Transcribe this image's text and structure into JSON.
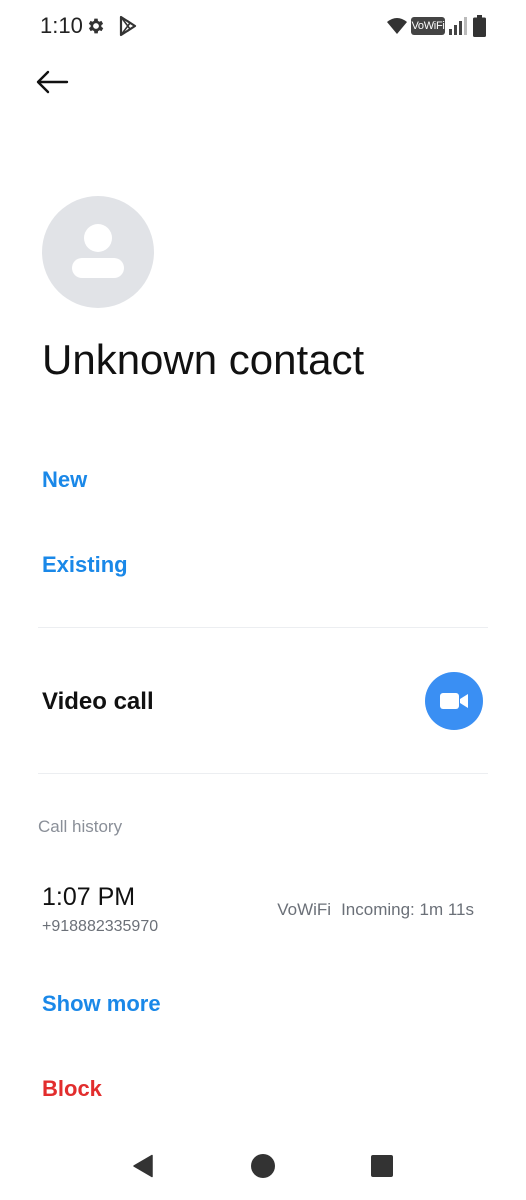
{
  "status_bar": {
    "time": "1:10",
    "icons": [
      "settings-icon",
      "play-store-icon",
      "wifi-icon",
      "vowifi-badge",
      "signal-icon",
      "battery-icon"
    ],
    "vowifi_label": "VoWiFi"
  },
  "header": {
    "back_icon": "arrow-left-icon"
  },
  "contact": {
    "avatar_icon": "person-placeholder-icon",
    "name": "Unknown contact"
  },
  "add_contact": {
    "new_label": "New",
    "existing_label": "Existing"
  },
  "video_call": {
    "label": "Video call",
    "icon": "video-camera-icon"
  },
  "call_history": {
    "header": "Call history",
    "entries": [
      {
        "time": "1:07 PM",
        "number": "+918882335970",
        "network": "VoWiFi",
        "detail": "Incoming: 1m 11s"
      }
    ],
    "show_more_label": "Show more"
  },
  "block": {
    "label": "Block"
  },
  "nav_bar": {
    "icons": [
      "back-triangle-icon",
      "home-circle-icon",
      "recents-square-icon"
    ]
  },
  "colors": {
    "link_blue": "#1a88e8",
    "danger_red": "#e22d2d",
    "video_button_blue": "#3a8ff3",
    "avatar_bg": "#e1e3e7",
    "muted_text": "#8a8f98"
  }
}
